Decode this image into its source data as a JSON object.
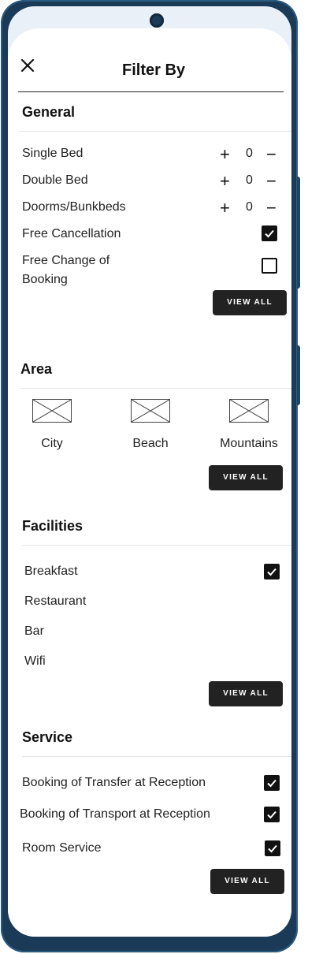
{
  "header": {
    "title": "Filter By",
    "close_icon": "close-icon"
  },
  "general": {
    "title": "General",
    "steppers": [
      {
        "label": "Single Bed",
        "plus": "+",
        "value": "0",
        "minus": "−"
      },
      {
        "label": "Double Bed",
        "plus": "+",
        "value": "0",
        "minus": "−"
      },
      {
        "label": "Doorms/Bunkbeds",
        "plus": "+",
        "value": "0",
        "minus": "−"
      }
    ],
    "checks": [
      {
        "label": "Free Cancellation",
        "checked": true
      },
      {
        "label_line1": "Free Change of",
        "label_line2": "Booking",
        "checked": false
      }
    ],
    "view_all": "VIEW ALL"
  },
  "area": {
    "title": "Area",
    "items": [
      {
        "label": "City"
      },
      {
        "label": "Beach"
      },
      {
        "label": "Mountains"
      }
    ],
    "view_all": "VIEW ALL"
  },
  "facilities": {
    "title": "Facilities",
    "items": [
      {
        "label": "Breakfast",
        "checked": true
      },
      {
        "label": "Restaurant"
      },
      {
        "label": "Bar"
      },
      {
        "label": "Wifi"
      }
    ],
    "view_all": "VIEW ALL"
  },
  "service": {
    "title": "Service",
    "items": [
      {
        "label": "Booking of Transfer at Reception",
        "checked": true
      },
      {
        "label": "Booking of Transport at Reception",
        "checked": true
      },
      {
        "label": "Room Service",
        "checked": true
      }
    ],
    "view_all": "VIEW ALL"
  },
  "colors": {
    "frame": "#1b3a57",
    "button": "#222222",
    "screen_bg": "#eaf0f7"
  }
}
